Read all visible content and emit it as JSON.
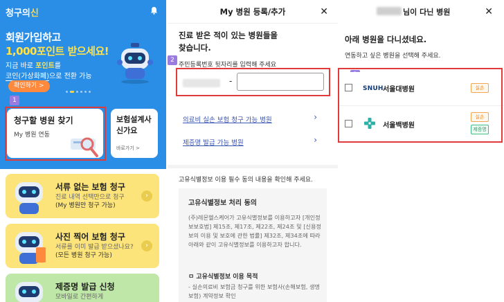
{
  "panel1": {
    "app_name_a": "청구의",
    "app_name_b": "신",
    "headline_line1": "회원가입하고",
    "headline_line2": "1,000포인트 받으세요!",
    "sub_line1_a": "지금 바로 ",
    "sub_line1_b": "포인트",
    "sub_line1_c": "를",
    "sub_line2_a": "코인(가상화폐)",
    "sub_line2_b": "으로 전환 가능",
    "confirm_button": "확인하기 >",
    "badge": "1",
    "card1_title": "청구할 병원 찾기",
    "card1_sub": "My 병원 연동",
    "card2_title": "보험설계사 신가요",
    "card2_sub": "바로가기 >",
    "services": [
      {
        "title": "서류 없는 보험 청구",
        "sub": "진료 내역 선택만으로 청구",
        "sub2": "(My 병원만 청구 가능)"
      },
      {
        "title": "사진 찍어 보험 청구",
        "sub": "서류를 이미 발급 받으셨나요?",
        "sub2": "(모든 병원 청구 가능)"
      },
      {
        "title": "제증명 발급 신청",
        "sub": "모바일로 간편하게",
        "sub2": ""
      }
    ],
    "arrow": "›"
  },
  "panel2": {
    "title": "My 병원 등록/추가",
    "close": "✕",
    "intro_line1": "진료 받은 적이 있는 병원들을",
    "intro_line2": "찾습니다.",
    "badge": "2",
    "rrn_label": "주민등록번호 뒷자리를 입력해 주세요",
    "dash": "-",
    "link1": "의료비 실손 보험 청구 가능 병원",
    "link2": "제증명 발급 가능 병원",
    "chevron": "›",
    "consent_note": "고유식별정보 이용 필수 동의 내용을 확인해 주세요.",
    "box_title": "고유식별정보 처리 동의",
    "box_body": "(주)레몬헬스케어가 고유식별정보를 이용하고자 [개인정보보호법] 제15조, 제17조, 제22조, 제24조 및 [신용정보의 이용 및 보호에 관한 법률] 제32조, 제34조에 따라 아래와 같이 고유식별정보를 이용하고자 합니다.",
    "box_h2": "ㅁ 고유식별정보 이용 목적",
    "box_body2": "- 실손의료비 보험금 청구를 위한 보험사(손해보험, 생명보험) 계약정보 확인"
  },
  "panel3": {
    "title": "님이 다닌 병원",
    "close": "✕",
    "heading": "아래 병원을 다니셨네요.",
    "sub": "연동하고 싶은 병원을 선택해 주세요.",
    "badge": "3",
    "hospitals": [
      {
        "logo": "SNUH",
        "name": "서울대병원",
        "tags": [
          "실손"
        ]
      },
      {
        "logo": "",
        "name": "서울백병원",
        "tags": [
          "실손",
          "제증명"
        ]
      }
    ],
    "colors": {
      "orange_tag": "#f08a1e",
      "green_tag": "#2a9d66"
    }
  },
  "colors": {
    "brand_blue": "#2a8ee6",
    "highlight_red": "#e03a3a",
    "badge_purple": "#9a7be0",
    "link_blue": "#3b55b3"
  }
}
